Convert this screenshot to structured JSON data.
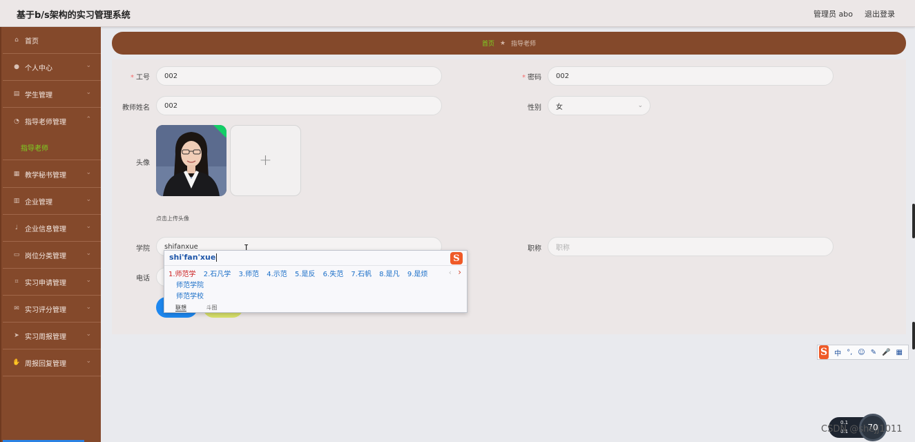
{
  "header": {
    "title": "基于b/s架构的实习管理系统",
    "admin_label": "管理员 abo",
    "logout_label": "退出登录"
  },
  "sidebar": {
    "items": [
      {
        "label": "首页",
        "icon": "home-icon"
      },
      {
        "label": "个人中心",
        "icon": "user-icon"
      },
      {
        "label": "学生管理",
        "icon": "bank-icon"
      },
      {
        "label": "指导老师管理",
        "icon": "gauge-icon"
      },
      {
        "label": "教学秘书管理",
        "icon": "grid-icon"
      },
      {
        "label": "企业管理",
        "icon": "building-icon"
      },
      {
        "label": "企业信息管理",
        "icon": "mic-icon"
      },
      {
        "label": "岗位分类管理",
        "icon": "chat-icon"
      },
      {
        "label": "实习申请管理",
        "icon": "crop-icon"
      },
      {
        "label": "实习评分管理",
        "icon": "mail-icon"
      },
      {
        "label": "实习周报管理",
        "icon": "send-icon"
      },
      {
        "label": "周报回复管理",
        "icon": "thumb-icon"
      }
    ],
    "active_sub": "指导老师",
    "active_sub_color": "#7ed321"
  },
  "breadcrumb": {
    "home": "首页",
    "current": "指导老师"
  },
  "form": {
    "job_id": {
      "label": "工号",
      "value": "002"
    },
    "password": {
      "label": "密码",
      "value": "002"
    },
    "teacher_name": {
      "label": "教师姓名",
      "value": "002"
    },
    "gender": {
      "label": "性别",
      "value": "女"
    },
    "avatar": {
      "label": "头像",
      "upload_hint": "点击上传头像",
      "plus": "+"
    },
    "college": {
      "label": "学院",
      "value": "shifanxue"
    },
    "title": {
      "label": "职称",
      "placeholder": "职称"
    },
    "phone": {
      "label": "电话"
    }
  },
  "ime_popup": {
    "pinyin": "shi'fan'xue",
    "candidates": [
      "1.师范学",
      "2.石凡学",
      "3.师范",
      "4.示范",
      "5.是反",
      "6.失范",
      "7.石帆",
      "8.是凡",
      "9.是烦"
    ],
    "extra_candidates": [
      "师范学院",
      "师范学校"
    ],
    "tabs": [
      "联想",
      "斗图"
    ],
    "logo": "S"
  },
  "ime_bar": {
    "logo": "S",
    "buttons": [
      "中",
      "°,",
      "☺",
      "✎",
      "🎤",
      "▦"
    ]
  },
  "tray": {
    "net_up": "0.1",
    "net_down": "0.1",
    "gauge_value": "70",
    "watermark": "CSDN @shejj1011"
  },
  "colors": {
    "sidebar_bg": "#84492b",
    "primary": "#1e88f0",
    "active_green": "#7ed321"
  }
}
